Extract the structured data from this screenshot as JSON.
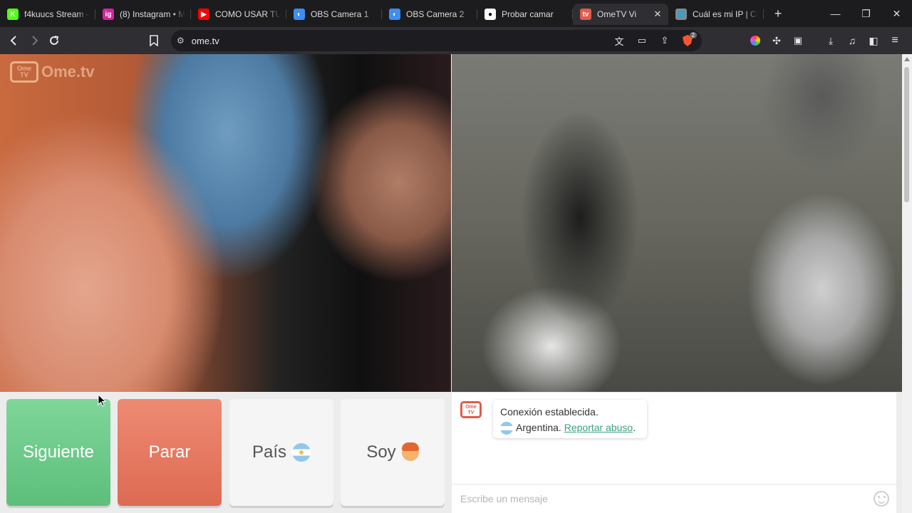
{
  "browser": {
    "tabs": [
      {
        "title": "f4kuucs Stream -",
        "favicon": "K",
        "color": "#53fc18"
      },
      {
        "title": "(8) Instagram • M",
        "favicon": "ig",
        "color": "#d6249f"
      },
      {
        "title": "COMO USAR TU C",
        "favicon": "▶",
        "color": "#ff0000"
      },
      {
        "title": "OBS Camera 1",
        "favicon": "◐",
        "color": "#3d8ef0"
      },
      {
        "title": "OBS Camera 2",
        "favicon": "◐",
        "color": "#3d8ef0"
      },
      {
        "title": "Probar camar",
        "favicon": "●",
        "color": "#ffffff"
      },
      {
        "title": "OmeTV Vi",
        "favicon": "tv",
        "color": "#e15b4d"
      },
      {
        "title": "Cuál es mi IP | Có",
        "favicon": "🌐",
        "color": "#888888"
      }
    ],
    "active_tab_index": 6,
    "url": "ome.tv",
    "shield_count": "2"
  },
  "page": {
    "logo_line1": "Ome",
    "logo_line2": "TV",
    "logo_text": "Ome.tv",
    "buttons": {
      "next": "Siguiente",
      "stop": "Parar",
      "country": "País",
      "gender": "Soy"
    },
    "chat": {
      "status": "Conexión establecida.",
      "country": "Argentina.",
      "report_link": "Reportar abuso",
      "report_suffix": ".",
      "placeholder": "Escribe un mensaje"
    }
  }
}
